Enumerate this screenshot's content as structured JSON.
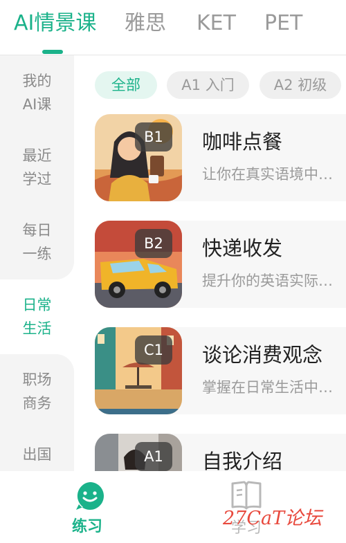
{
  "top_tabs": [
    {
      "label": "AI情景课",
      "active": true
    },
    {
      "label": "雅思",
      "active": false
    },
    {
      "label": "KET",
      "active": false
    },
    {
      "label": "PET",
      "active": false
    }
  ],
  "sidebar": {
    "items": [
      {
        "line1": "我的",
        "line2": "AI课"
      },
      {
        "line1": "最近",
        "line2": "学过"
      },
      {
        "line1": "每日",
        "line2": "一练"
      },
      {
        "line1": "日常",
        "line2": "生活",
        "active": true
      },
      {
        "line1": "职场",
        "line2": "商务"
      },
      {
        "line1": "出国",
        "line2": ""
      }
    ]
  },
  "filters": [
    {
      "label": "全部",
      "active": true
    },
    {
      "label": "A1 入门"
    },
    {
      "label": "A2 初级"
    }
  ],
  "courses": [
    {
      "title": "咖啡点餐",
      "level": "B1",
      "desc": "让你在真实语境中…",
      "thumb_icon": "cafe-girl-illustration"
    },
    {
      "title": "快递收发",
      "level": "B2",
      "desc": "提升你的英语实际…",
      "thumb_icon": "delivery-van-illustration"
    },
    {
      "title": "谈论消费观念",
      "level": "C1",
      "desc": "掌握在日常生活中…",
      "thumb_icon": "street-market-illustration"
    },
    {
      "title": "自我介绍",
      "level": "A1",
      "desc": "",
      "thumb_icon": "city-woman-photo"
    }
  ],
  "bottom_nav": {
    "practice_label": "练习",
    "study_label": "学习",
    "watermark": "27CaT论坛"
  },
  "colors": {
    "accent": "#1bb28a",
    "inactive": "#9a9a9a",
    "watermark": "#e8493d"
  }
}
